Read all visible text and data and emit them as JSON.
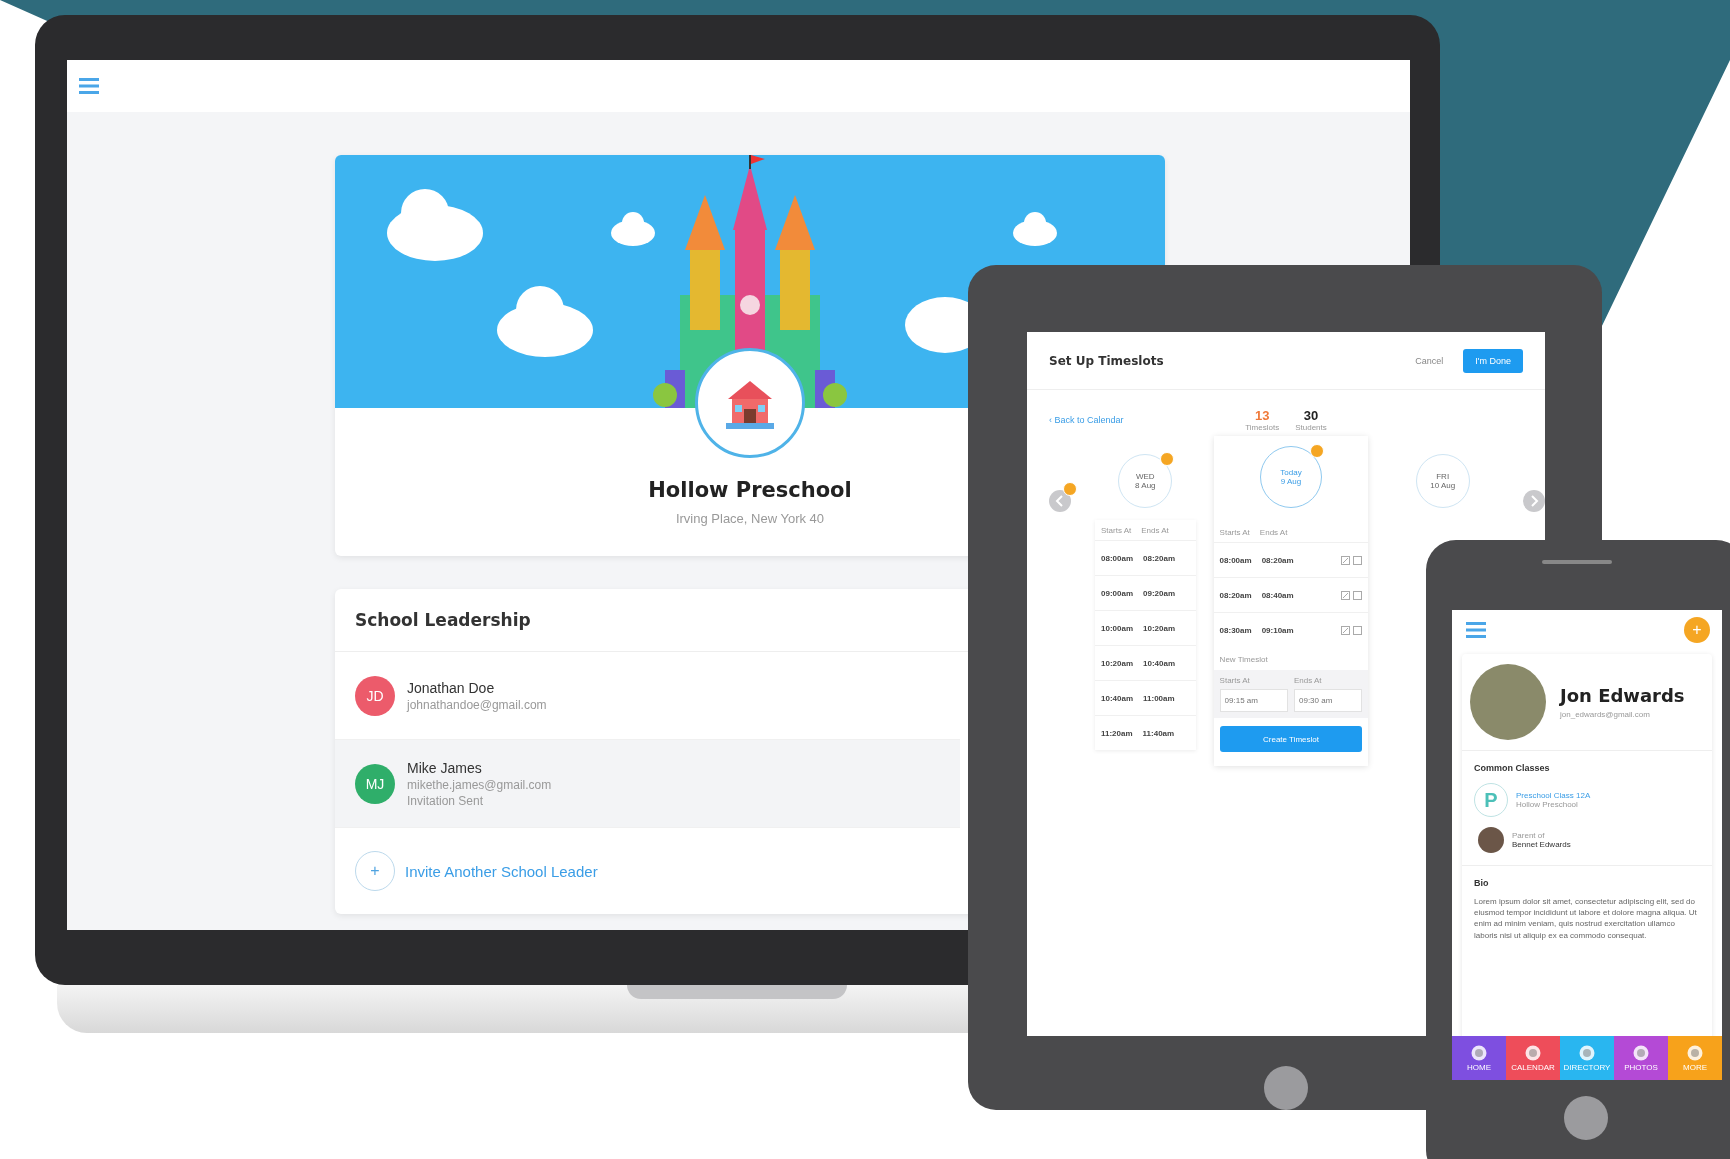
{
  "laptop": {
    "school": {
      "name": "Hollow Preschool",
      "address": "Irving Place, New York 40"
    },
    "leadership": {
      "title": "School Leadership",
      "members": [
        {
          "initials": "JD",
          "name": "Jonathan Doe",
          "email": "johnathandoe@gmail.com",
          "color": "#ec5b6b",
          "selected": false
        },
        {
          "initials": "MJ",
          "name": "Mike James",
          "email": "mikethe.james@gmail.com",
          "status": "Invitation Sent",
          "color": "#2fae6a",
          "selected": true
        }
      ],
      "invite": {
        "icon": "+",
        "label": "Invite Another School Leader"
      }
    }
  },
  "tablet": {
    "title": "Set Up Timeslots",
    "cancel": "Cancel",
    "done": "I'm Done",
    "back": "‹ Back to Calendar",
    "stats": [
      {
        "value": "13",
        "label": "Timeslots",
        "color": "#f07a3a"
      },
      {
        "value": "30",
        "label": "Students",
        "color": "#222222"
      }
    ],
    "prev": {
      "badge": true
    },
    "next": {
      "badge": false
    },
    "days": [
      {
        "weekday": "WED",
        "date": "8 Aug",
        "selected": false,
        "badge": true,
        "columns": [
          "Starts At",
          "Ends At"
        ],
        "rows": [
          [
            "08:00am",
            "08:20am"
          ],
          [
            "09:00am",
            "09:20am"
          ],
          [
            "10:00am",
            "10:20am"
          ],
          [
            "10:20am",
            "10:40am"
          ],
          [
            "10:40am",
            "11:00am"
          ],
          [
            "11:20am",
            "11:40am"
          ]
        ]
      },
      {
        "weekday": "Today",
        "date": "9 Aug",
        "selected": true,
        "badge": true,
        "columns": [
          "Starts At",
          "Ends At"
        ],
        "rows": [
          [
            "08:00am",
            "08:20am"
          ],
          [
            "08:20am",
            "08:40am"
          ],
          [
            "08:30am",
            "09:10am"
          ]
        ],
        "new_slot": {
          "title": "New Timeslot",
          "start_label": "Starts At",
          "end_label": "Ends At",
          "start_placeholder": "09:15 am",
          "end_placeholder": "09:30 am",
          "button": "Create Timeslot"
        }
      },
      {
        "weekday": "FRI",
        "date": "10 Aug",
        "selected": false,
        "badge": false
      }
    ]
  },
  "phone": {
    "add_button": "+",
    "name": "Jon Edwards",
    "email": "jon_edwards@gmail.com",
    "classes_title": "Common Classes",
    "classes": [
      {
        "initial": "P",
        "name": "Preschool Class 12A",
        "school": "Hollow Preschool"
      }
    ],
    "child": {
      "label": "Parent of",
      "name": "Bennet Edwards"
    },
    "bio_title": "Bio",
    "bio": "Lorem ipsum dolor sit amet, consectetur adipiscing elit, sed do eiusmod tempor incididunt ut labore et dolore magna aliqua. Ut enim ad minim veniam, quis nostrud exercitation ullamco laboris nisi ut aliquip ex ea commodo consequat.",
    "nav": [
      {
        "label": "HOME",
        "color": "#7e4fe0"
      },
      {
        "label": "CALENDAR",
        "color": "#ee4d5a"
      },
      {
        "label": "DIRECTORY",
        "color": "#29b6f0"
      },
      {
        "label": "PHOTOS",
        "color": "#b44ad6"
      },
      {
        "label": "MORE",
        "color": "#f7a21b"
      }
    ]
  }
}
